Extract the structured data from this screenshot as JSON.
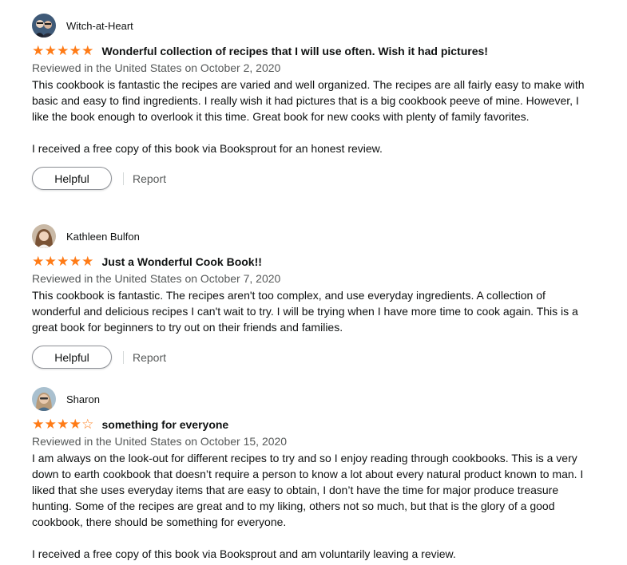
{
  "reviews": [
    {
      "reviewer": "Witch-at-Heart",
      "rating": 5,
      "stars": [
        "full",
        "full",
        "full",
        "full",
        "full"
      ],
      "title": "Wonderful collection of recipes that I will use often. Wish it had pictures!",
      "date": "Reviewed in the United States on October 2, 2020",
      "body": [
        "This cookbook is fantastic the recipes are varied and well organized. The recipes are all fairly easy to make with basic and easy to find ingredients. I really wish it had pictures that is a big cookbook peeve of mine. However, I like the book enough to overlook it this time. Great book for new cooks with plenty of family favorites.",
        "I received a free copy of this book via Booksprout for an honest review."
      ],
      "helpful_label": "Helpful",
      "report_label": "Report"
    },
    {
      "reviewer": "Kathleen Bulfon",
      "rating": 5,
      "stars": [
        "full",
        "full",
        "full",
        "full",
        "full"
      ],
      "title": "Just a Wonderful Cook Book!!",
      "date": "Reviewed in the United States on October 7, 2020",
      "body": [
        "This cookbook is fantastic. The recipes aren't too complex, and use everyday ingredients. A collection of wonderful and delicious recipes I can't wait to try. I will be trying when I have more time to cook again. This is a great book for beginners to try out on their friends and families."
      ],
      "helpful_label": "Helpful",
      "report_label": "Report"
    },
    {
      "reviewer": "Sharon",
      "rating": 4,
      "stars": [
        "full",
        "full",
        "full",
        "full",
        "empty"
      ],
      "title": "something for everyone",
      "date": "Reviewed in the United States on October 15, 2020",
      "body": [
        "I am always on the look-out for different recipes to try and so I enjoy reading through cookbooks. This is a very down to earth cookbook that doesn’t require a person to know a lot about every natural product known to man. I liked that she uses everyday items that are easy to obtain, I don’t have the time for major produce treasure hunting. Some of the recipes are great and to my liking, others not so much, but that is the glory of a good cookbook, there should be something for everyone.",
        "I received a free copy of this book via Booksprout and am voluntarily leaving a review."
      ]
    }
  ],
  "colors": {
    "star": "#ff7b16",
    "text": "#0f1111",
    "muted": "#565959",
    "button_border": "#8d9096"
  },
  "icons": {
    "star_full": "★",
    "star_empty": "☆"
  }
}
